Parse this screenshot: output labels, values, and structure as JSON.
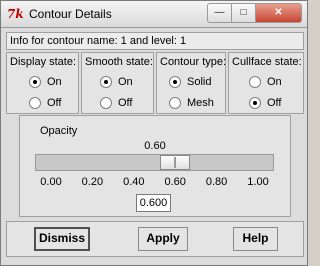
{
  "window": {
    "title": "Contour Details",
    "app_icon_glyph": "7k",
    "minimize_glyph": "—",
    "maximize_glyph": "□",
    "close_glyph": "✕"
  },
  "info_text": "Info for contour name: 1 and level: 1",
  "groups": [
    {
      "title": "Display state:",
      "options": [
        "On",
        "Off"
      ],
      "selected": "On"
    },
    {
      "title": "Smooth state:",
      "options": [
        "On",
        "Off"
      ],
      "selected": "On"
    },
    {
      "title": "Contour type:",
      "options": [
        "Solid",
        "Mesh"
      ],
      "selected": "Solid"
    },
    {
      "title": "Cullface state:",
      "options": [
        "On",
        "Off"
      ],
      "selected": "Off"
    }
  ],
  "opacity": {
    "label": "Opacity",
    "value_display": "0.60",
    "value": 0.6,
    "min": 0,
    "max": 1,
    "ticks": [
      "0.00",
      "0.20",
      "0.40",
      "0.60",
      "0.80",
      "1.00"
    ],
    "entry_value": "0.600"
  },
  "buttons": {
    "dismiss": "Dismiss",
    "apply": "Apply",
    "help": "Help"
  },
  "colors": {
    "close_button": "#c74532",
    "app_icon": "#c00000"
  }
}
